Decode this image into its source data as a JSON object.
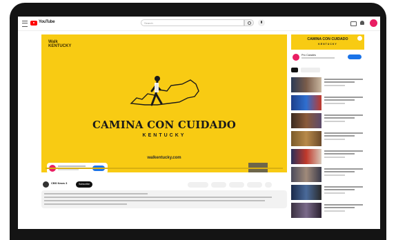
{
  "topbar": {
    "brand": "YouTube",
    "search_placeholder": "Search"
  },
  "player": {
    "wordmark_top": "Walk",
    "wordmark_bottom": "KENTUCKY",
    "headline": "CAMINA CON CUIDADO",
    "state": "KENTUCKY",
    "url": "walkentucky.com"
  },
  "video": {
    "channel_name": "CBS News 3",
    "subscribe_label": "Subscribe"
  },
  "sidebar": {
    "ad_headline": "CAMINA CON CUIDADO",
    "ad_state": "KENTUCKY",
    "ad_channel": "Pro Canales"
  },
  "colors": {
    "brand_yellow": "#f8cb13",
    "youtube_red": "#ff0000",
    "subscribe_bg": "#0f0f0f",
    "cta_blue": "#1a73e8"
  }
}
